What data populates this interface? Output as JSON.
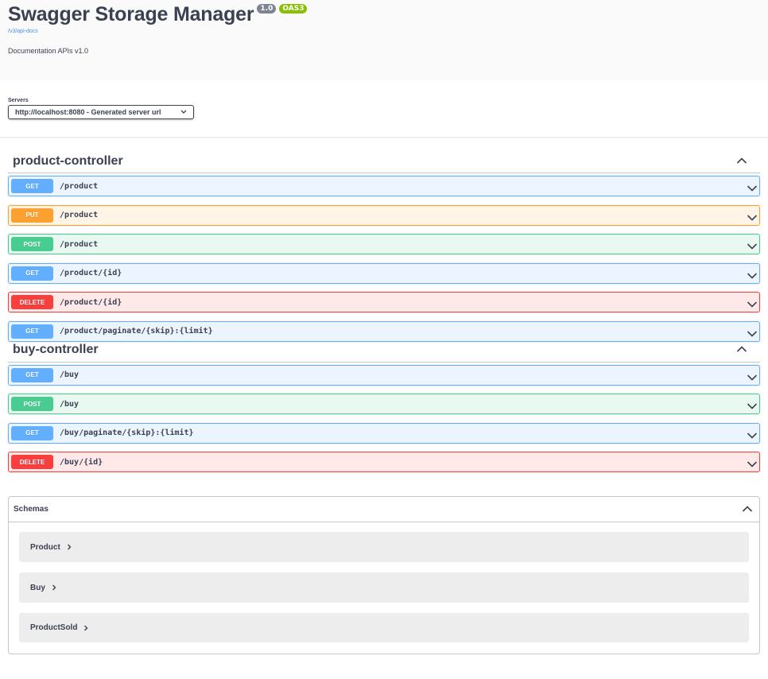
{
  "info": {
    "title": "Swagger Storage Manager",
    "version_badge": "1.0",
    "oas_badge": "OAS3",
    "api_docs_link": "/v3/api-docs",
    "description": "Documentation APIs v1.0"
  },
  "servers": {
    "label": "Servers",
    "selected": "http://localhost:8080 - Generated server url"
  },
  "tags": [
    {
      "name": "product-controller",
      "operations": [
        {
          "method": "GET",
          "path": "/product"
        },
        {
          "method": "PUT",
          "path": "/product"
        },
        {
          "method": "POST",
          "path": "/product"
        },
        {
          "method": "GET",
          "path": "/product/{id}"
        },
        {
          "method": "DELETE",
          "path": "/product/{id}"
        },
        {
          "method": "GET",
          "path": "/product/paginate/{skip}:{limit}"
        }
      ]
    },
    {
      "name": "buy-controller",
      "operations": [
        {
          "method": "GET",
          "path": "/buy"
        },
        {
          "method": "POST",
          "path": "/buy"
        },
        {
          "method": "GET",
          "path": "/buy/paginate/{skip}:{limit}"
        },
        {
          "method": "DELETE",
          "path": "/buy/{id}"
        }
      ]
    }
  ],
  "schemas": {
    "title": "Schemas",
    "models": [
      "Product",
      "Buy",
      "ProductSold"
    ]
  },
  "colors": {
    "get": "#61affe",
    "put": "#fca130",
    "post": "#49cc90",
    "delete": "#f93e3e"
  }
}
